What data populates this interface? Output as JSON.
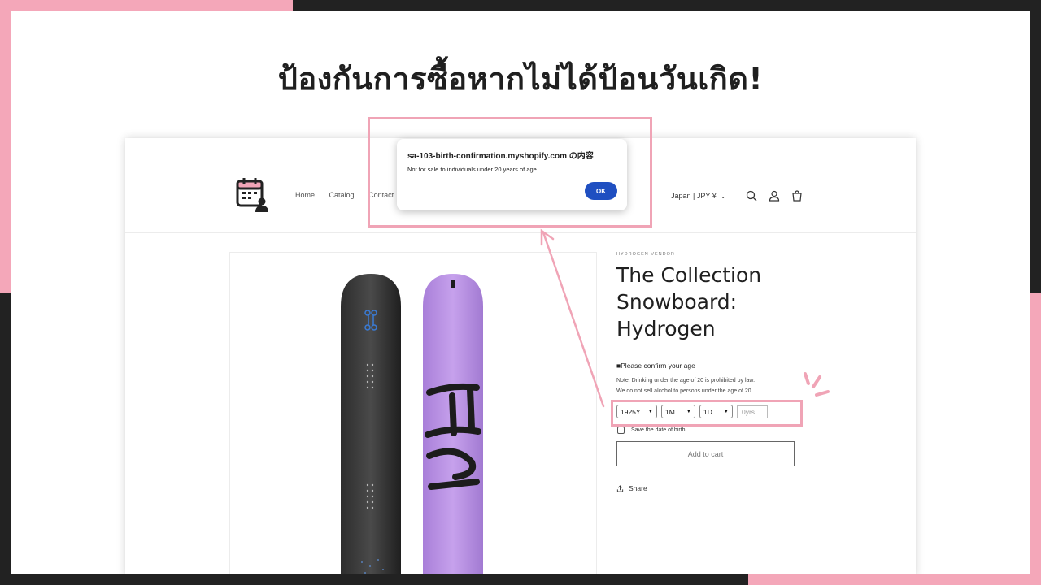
{
  "headline": "ป้องกันการซื้อหากไม่ได้ป้อนวันเกิด!",
  "store": {
    "nav": [
      "Home",
      "Catalog",
      "Contact"
    ],
    "currency": "Japan | JPY ¥",
    "vendor": "HYDROGEN VENDOR",
    "title": "The Collection Snowboard: Hydrogen",
    "confirm_label": "■Please confirm your age",
    "note_line1": "Note: Drinking under the age of 20 is prohibited by law.",
    "note_line2": "We do not sell alcohol to persons under the age of 20.",
    "year": "1925Y",
    "month": "1M",
    "day": "1D",
    "age_placeholder": "0yrs",
    "save_label": "Save the date of birth",
    "add_to_cart": "Add to cart",
    "share": "Share"
  },
  "dialog": {
    "title": "sa-103-birth-confirmation.myshopify.com の内容",
    "message": "Not for sale to individuals under 20 years of age.",
    "ok": "OK"
  },
  "colors": {
    "accent_pink": "#f0a4b6",
    "ok_blue": "#1f4fc1",
    "board_purple": "#b48be0",
    "board_black": "#2a2a2a"
  }
}
